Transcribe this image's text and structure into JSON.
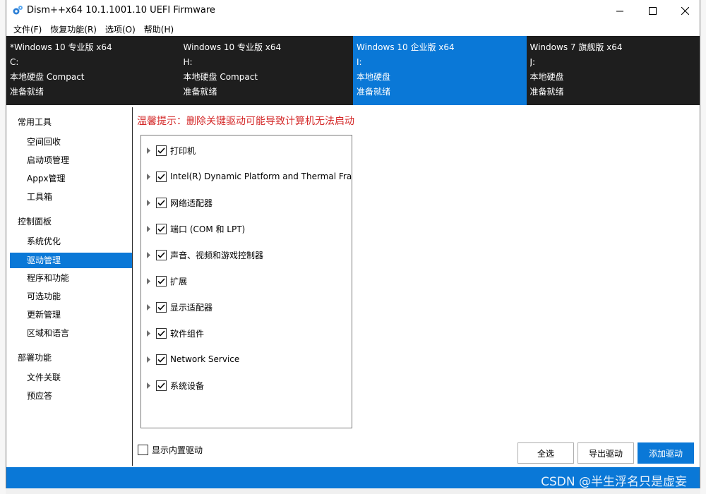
{
  "window": {
    "title": "Dism++x64 10.1.1001.10 UEFI Firmware",
    "controls": {
      "minimize": "minimize",
      "maximize": "maximize",
      "close": "close"
    }
  },
  "menu": [
    "文件(F)",
    "恢复功能(R)",
    "选项(O)",
    "帮助(H)"
  ],
  "tabs": [
    {
      "name": "*Windows 10 专业版 x64",
      "drive": "C:",
      "type": "本地硬盘 Compact",
      "status": "准备就绪"
    },
    {
      "name": "Windows 10 专业版 x64",
      "drive": "H:",
      "type": "本地硬盘 Compact",
      "status": "准备就绪"
    },
    {
      "name": "Windows 10 企业版 x64",
      "drive": "I:",
      "type": "本地硬盘",
      "status": "准备就绪"
    },
    {
      "name": "Windows 7 旗舰版 x64",
      "drive": "J:",
      "type": "本地硬盘",
      "status": "准备就绪"
    }
  ],
  "sidebar": {
    "groups": [
      {
        "title": "常用工具",
        "items": [
          "空间回收",
          "启动项管理",
          "Appx管理",
          "工具箱"
        ]
      },
      {
        "title": "控制面板",
        "items": [
          "系统优化",
          "驱动管理",
          "程序和功能",
          "可选功能",
          "更新管理",
          "区域和语言"
        ]
      },
      {
        "title": "部署功能",
        "items": [
          "文件关联",
          "预应答"
        ]
      }
    ],
    "active_item": "驱动管理"
  },
  "warning": "温馨提示：删除关键驱动可能导致计算机无法启动",
  "driver_tree": [
    {
      "label": "打印机",
      "checked": true
    },
    {
      "label": "Intel(R) Dynamic Platform and Thermal Fra",
      "checked": true
    },
    {
      "label": "网络适配器",
      "checked": true
    },
    {
      "label": "端口 (COM 和 LPT)",
      "checked": true
    },
    {
      "label": "声音、视频和游戏控制器",
      "checked": true
    },
    {
      "label": "扩展",
      "checked": true
    },
    {
      "label": "显示适配器",
      "checked": true
    },
    {
      "label": "软件组件",
      "checked": true
    },
    {
      "label": "Network Service",
      "checked": true
    },
    {
      "label": "系统设备",
      "checked": true
    }
  ],
  "show_builtin": {
    "label": "显示内置驱动",
    "checked": false
  },
  "buttons": {
    "select_all": "全选",
    "export": "导出驱动",
    "add": "添加驱动"
  },
  "watermark": "CSDN @半生浮名只是虚妄",
  "colors": {
    "accent": "#0a78d7",
    "warning": "#d42a2a",
    "tab_bg": "#1e1e1e"
  }
}
